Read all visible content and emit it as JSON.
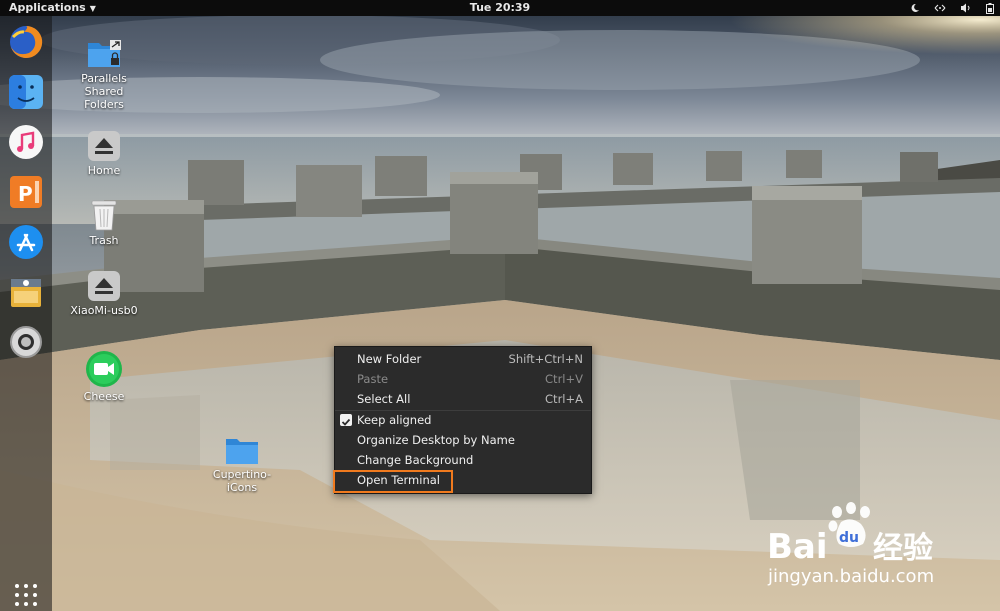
{
  "topbar": {
    "applications_label": "Applications",
    "clock": "Tue 20:39",
    "tray_icons": [
      "night-mode-icon",
      "network-icon",
      "volume-icon",
      "battery-icon"
    ]
  },
  "dock": {
    "items": [
      {
        "name": "Firefox",
        "icon": "firefox-icon"
      },
      {
        "name": "Finder",
        "icon": "finder-icon"
      },
      {
        "name": "Music",
        "icon": "music-icon"
      },
      {
        "name": "WPS Presentation",
        "icon": "presentation-icon"
      },
      {
        "name": "App Store",
        "icon": "app-store-icon"
      },
      {
        "name": "Software",
        "icon": "software-icon"
      },
      {
        "name": "Help",
        "icon": "help-icon"
      }
    ],
    "show_apps_icon": "app-grid-icon"
  },
  "desktop": {
    "icons": [
      {
        "label": "Parallels Shared Folders",
        "icon": "shared-folder-icon"
      },
      {
        "label": "Home",
        "icon": "eject-icon"
      },
      {
        "label": "Trash",
        "icon": "trash-icon"
      },
      {
        "label": "XiaoMi-usb0",
        "icon": "eject-icon"
      },
      {
        "label": "Cheese",
        "icon": "camera-icon"
      },
      {
        "label": "Cupertino-iCons",
        "icon": "folder-icon"
      }
    ]
  },
  "context_menu": {
    "items": [
      {
        "label": "New Folder",
        "accel": "Shift+Ctrl+N",
        "enabled": true
      },
      {
        "label": "Paste",
        "accel": "Ctrl+V",
        "enabled": false
      },
      {
        "label": "Select All",
        "accel": "Ctrl+A",
        "enabled": true
      },
      {
        "label": "Keep aligned",
        "checked": true,
        "enabled": true
      },
      {
        "label": "Organize Desktop by Name",
        "enabled": true
      },
      {
        "label": "Change Background",
        "enabled": true
      },
      {
        "label": "Open Terminal",
        "enabled": true,
        "highlighted": true
      }
    ],
    "highlight_color": "#f07a1e"
  },
  "watermark": {
    "brand": "Bai",
    "brand_suffix": "经验",
    "url": "jingyan.baidu.com"
  }
}
